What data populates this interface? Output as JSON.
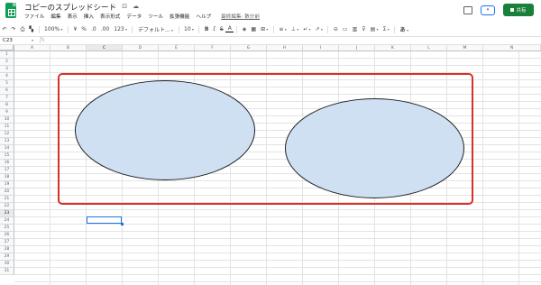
{
  "app": {
    "doc_title": "コピーのスプレッドシート",
    "title_icons": [
      "star-icon",
      "folder-icon",
      "cloud-icon"
    ],
    "share_label": "共有",
    "present_label": "▾"
  },
  "menu": {
    "items": [
      "ファイル",
      "編集",
      "表示",
      "挿入",
      "表示形式",
      "データ",
      "ツール",
      "拡張機能",
      "ヘルプ"
    ],
    "last_edit": "最終編集: 数分前"
  },
  "toolbar": {
    "undo": "↶",
    "redo": "↷",
    "print": "⎙",
    "paint_format": "▚",
    "zoom": "100%",
    "currency": "¥",
    "percent": "%",
    "decimal_less": ".0",
    "decimal_more": ".00",
    "more_formats": "123",
    "font": "デフォルト...",
    "font_size": "10",
    "bold": "B",
    "italic": "I",
    "strike": "S",
    "text_color": "A",
    "fill": "◈",
    "borders": "▦",
    "merge": "⊞",
    "align": "≡",
    "valign": "⊥",
    "wrap": "↵",
    "rotate": "↗",
    "link": "⊝",
    "comment": "▭",
    "chart": "▥",
    "filter": "⊽",
    "view": "▤",
    "functions": "Σ",
    "input_tools": "あ"
  },
  "formula_bar": {
    "cell_ref": "C23",
    "fx": "fx"
  },
  "sheet": {
    "columns": [
      "A",
      "B",
      "C",
      "D",
      "E",
      "F",
      "G",
      "H",
      "I",
      "J",
      "K",
      "L",
      "M",
      "N"
    ],
    "rows": [
      "1",
      "2",
      "3",
      "4",
      "5",
      "6",
      "7",
      "8",
      "9",
      "10",
      "11",
      "12",
      "13",
      "14",
      "15",
      "16",
      "17",
      "18",
      "19",
      "20",
      "21",
      "22",
      "23",
      "24",
      "25",
      "26",
      "27",
      "28",
      "29",
      "30",
      "31"
    ],
    "selected_column": "C",
    "selected_row": "23"
  },
  "colors": {
    "highlight_border": "#d93025",
    "ellipse_fill": "#cfe0f3",
    "share_button": "#188038",
    "selection": "#1a73e8"
  }
}
